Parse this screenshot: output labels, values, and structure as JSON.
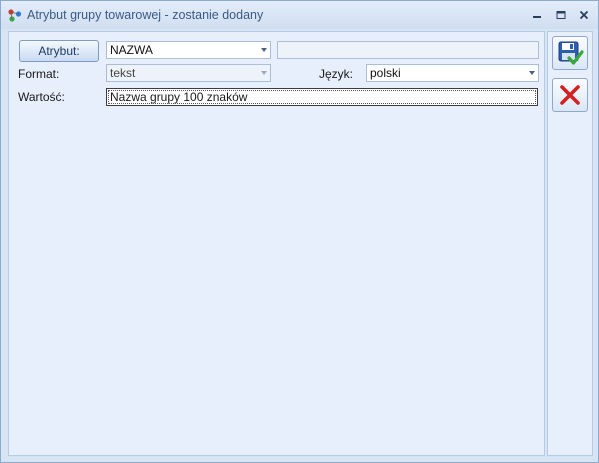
{
  "window": {
    "title": "Atrybut grupy towarowej - zostanie dodany",
    "controls": [
      "minimize",
      "maximize",
      "close"
    ]
  },
  "form": {
    "attribute_button_label": "Atrybut:",
    "attribute_value": "NAZWA",
    "attribute_description": "",
    "format_label": "Format:",
    "format_value": "tekst",
    "language_label": "Język:",
    "language_value": "polski",
    "value_label": "Wartość:",
    "value_text": "Nazwa grupy 100 znaków"
  },
  "actions": {
    "save": "save-icon",
    "cancel": "cancel-icon"
  },
  "colors": {
    "accent": "#3b5a86",
    "cancel_red": "#d42020",
    "save_blue": "#2d5fb0",
    "check_green": "#3aa83a"
  }
}
